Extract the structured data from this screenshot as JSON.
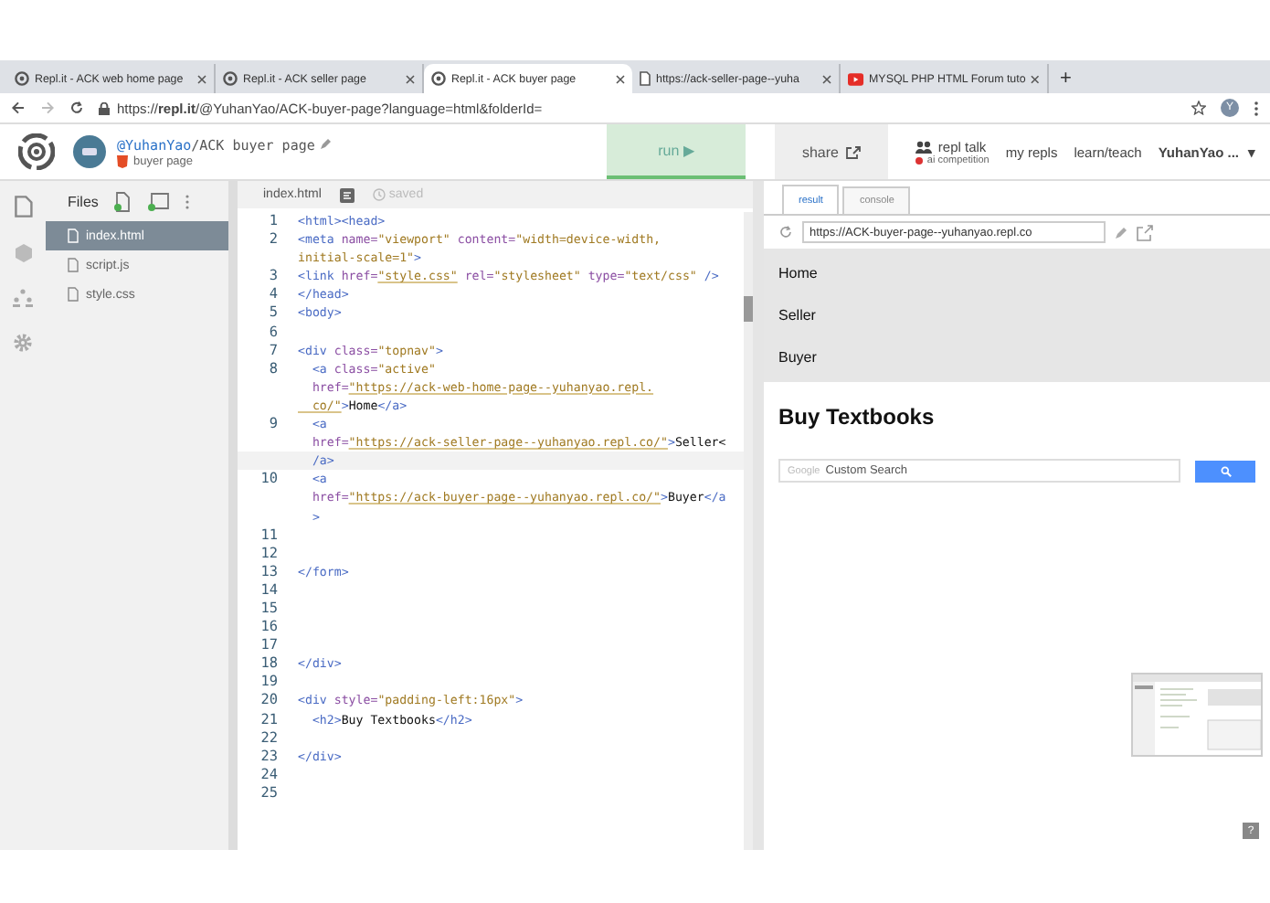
{
  "browser_tabs": [
    {
      "title": "Repl.it - ACK web home page",
      "kind": "repl",
      "selected": false
    },
    {
      "title": "Repl.it - ACK seller page",
      "kind": "repl",
      "selected": false
    },
    {
      "title": "Repl.it - ACK buyer page",
      "kind": "repl",
      "selected": true
    },
    {
      "title": "https://ack-seller-page--yuha",
      "kind": "page",
      "selected": false
    },
    {
      "title": "MYSQL PHP HTML Forum tuto",
      "kind": "video",
      "selected": false
    }
  ],
  "new_tab": "+",
  "address_bar": {
    "url": "https://**repl.it**/@YuhanYao/ACK-buyer-page?language=html&folderId="
  },
  "profile_initial": "Y",
  "header": {
    "owner": "@YuhanYao",
    "repl_name": "/ACK buyer page",
    "description": "buyer page",
    "run": "run ▶",
    "share": "share",
    "nav": [
      {
        "label": "repl talk",
        "badge": "ai competition"
      },
      {
        "label": "my repls"
      },
      {
        "label": "learn/teach"
      }
    ],
    "user": "YuhanYao ...",
    "user_caret": "▾"
  },
  "files": {
    "title": "Files",
    "items": [
      {
        "name": "index.html",
        "selected": true
      },
      {
        "name": "script.js",
        "selected": false
      },
      {
        "name": "style.css",
        "selected": false
      }
    ]
  },
  "editor": {
    "tab": "index.html",
    "status": "saved",
    "rows": [
      {
        "number": "1",
        "current": false,
        "segments": [
          {
            "kind": "tag",
            "text": "<html><head>"
          }
        ]
      },
      {
        "number": "2",
        "current": false,
        "segments": [
          {
            "kind": "tag",
            "text": "<meta "
          },
          {
            "kind": "attr",
            "text": "name="
          },
          {
            "kind": "str",
            "text": "\"viewport\""
          },
          {
            "kind": "attr",
            "text": " content="
          },
          {
            "kind": "str",
            "text": "\"width=device-width,"
          }
        ]
      },
      {
        "current": false,
        "segments": [
          {
            "kind": "str",
            "text": "initial-scale=1\""
          },
          {
            "kind": "tag",
            "text": ">"
          }
        ]
      },
      {
        "number": "3",
        "current": false,
        "segments": [
          {
            "kind": "tag",
            "text": "<link "
          },
          {
            "kind": "attr",
            "text": "href="
          },
          {
            "kind": "link",
            "text": "\"style.css\""
          },
          {
            "kind": "attr",
            "text": " rel="
          },
          {
            "kind": "str",
            "text": "\"stylesheet\""
          },
          {
            "kind": "attr",
            "text": " type="
          },
          {
            "kind": "str",
            "text": "\"text/css\""
          },
          {
            "kind": "tag",
            "text": " />"
          }
        ]
      },
      {
        "number": "4",
        "current": false,
        "segments": [
          {
            "kind": "tag",
            "text": "</head>"
          }
        ]
      },
      {
        "number": "5",
        "current": false,
        "segments": [
          {
            "kind": "tag",
            "text": "<body>"
          }
        ]
      },
      {
        "number": "6",
        "current": false,
        "segments": []
      },
      {
        "number": "7",
        "current": false,
        "segments": [
          {
            "kind": "tag",
            "text": "<div "
          },
          {
            "kind": "attr",
            "text": "class="
          },
          {
            "kind": "str",
            "text": "\"topnav\""
          },
          {
            "kind": "tag",
            "text": ">"
          }
        ]
      },
      {
        "number": "8",
        "current": false,
        "segments": [
          {
            "kind": "tag",
            "text": "  <a "
          },
          {
            "kind": "attr",
            "text": "class="
          },
          {
            "kind": "str",
            "text": "\"active\""
          }
        ]
      },
      {
        "current": false,
        "segments": [
          {
            "kind": "attr",
            "text": "  href="
          },
          {
            "kind": "link",
            "text": "\"https://ack-web-home-page--yuhanyao.repl."
          }
        ]
      },
      {
        "current": false,
        "segments": [
          {
            "kind": "link",
            "text": "  co/\""
          },
          {
            "kind": "tag",
            "text": ">"
          },
          {
            "kind": "text",
            "text": "Home"
          },
          {
            "kind": "tag",
            "text": "</a>"
          }
        ]
      },
      {
        "number": "9",
        "current": false,
        "segments": [
          {
            "kind": "tag",
            "text": "  <a"
          }
        ]
      },
      {
        "current": false,
        "segments": [
          {
            "kind": "attr",
            "text": "  href="
          },
          {
            "kind": "link",
            "text": "\"https://ack-seller-page--yuhanyao.repl.co/\""
          },
          {
            "kind": "tag",
            "text": ">"
          },
          {
            "kind": "text",
            "text": "Seller<"
          }
        ]
      },
      {
        "current": true,
        "segments": [
          {
            "kind": "tag",
            "text": "  /a>"
          }
        ]
      },
      {
        "number": "10",
        "current": false,
        "segments": [
          {
            "kind": "tag",
            "text": "  <a"
          }
        ]
      },
      {
        "current": false,
        "segments": [
          {
            "kind": "attr",
            "text": "  href="
          },
          {
            "kind": "link",
            "text": "\"https://ack-buyer-page--yuhanyao.repl.co/\""
          },
          {
            "kind": "tag",
            "text": ">"
          },
          {
            "kind": "text",
            "text": "Buyer"
          },
          {
            "kind": "tag",
            "text": "</a"
          }
        ]
      },
      {
        "current": false,
        "segments": [
          {
            "kind": "tag",
            "text": "  >"
          }
        ]
      },
      {
        "number": "11",
        "current": false,
        "segments": []
      },
      {
        "number": "12",
        "current": false,
        "segments": []
      },
      {
        "number": "13",
        "current": false,
        "segments": [
          {
            "kind": "tag",
            "text": "</form>"
          }
        ]
      },
      {
        "number": "14",
        "current": false,
        "segments": []
      },
      {
        "number": "15",
        "current": false,
        "segments": []
      },
      {
        "number": "16",
        "current": false,
        "segments": []
      },
      {
        "number": "17",
        "current": false,
        "segments": []
      },
      {
        "number": "18",
        "current": false,
        "segments": [
          {
            "kind": "tag",
            "text": "</div>"
          }
        ]
      },
      {
        "number": "19",
        "current": false,
        "segments": []
      },
      {
        "number": "20",
        "current": false,
        "segments": [
          {
            "kind": "tag",
            "text": "<div "
          },
          {
            "kind": "attr",
            "text": "style="
          },
          {
            "kind": "str",
            "text": "\"padding-left:16px\""
          },
          {
            "kind": "tag",
            "text": ">"
          }
        ]
      },
      {
        "number": "21",
        "current": false,
        "segments": [
          {
            "kind": "tag",
            "text": "  <h2>"
          },
          {
            "kind": "text",
            "text": "Buy Textbooks"
          },
          {
            "kind": "tag",
            "text": "</h2>"
          }
        ]
      },
      {
        "number": "22",
        "current": false,
        "segments": []
      },
      {
        "number": "23",
        "current": false,
        "segments": [
          {
            "kind": "tag",
            "text": "</div>"
          }
        ]
      },
      {
        "number": "24",
        "current": false,
        "segments": []
      },
      {
        "number": "25",
        "current": false,
        "segments": []
      }
    ]
  },
  "preview": {
    "tabs": [
      {
        "label": "result",
        "selected": true
      },
      {
        "label": "console",
        "selected": false
      }
    ],
    "url": "https://ACK-buyer-page--yuhanyao.repl.co",
    "nav": [
      "Home",
      "Seller",
      "Buyer"
    ],
    "heading": "Buy Textbooks",
    "search": {
      "brand": "Google",
      "placeholder": "Custom Search"
    }
  },
  "help": "?"
}
